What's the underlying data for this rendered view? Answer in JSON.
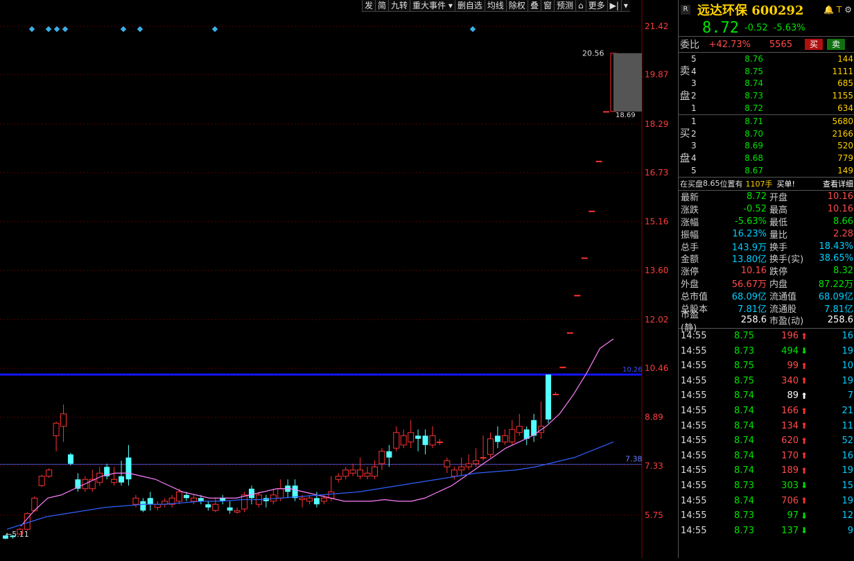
{
  "toolbar": {
    "items": [
      "发",
      "简",
      "九转",
      "重大事件 ▾",
      "删自选",
      "均线",
      "除权",
      "叠",
      "窗",
      "预测",
      "⌂",
      "更多",
      "▶|",
      "▾"
    ]
  },
  "chart": {
    "y_labels": [
      "21.42",
      "19.87",
      "18.29",
      "16.73",
      "15.16",
      "13.60",
      "12.02",
      "10.46",
      "8.89",
      "7.33",
      "5.75"
    ],
    "annotations": {
      "high": "20.56",
      "low_box": "18.69",
      "line1": "10.26",
      "line2": "7.38",
      "low": "5.11"
    },
    "colors": {
      "up": "#ff3232",
      "down": "#54ffff",
      "ma1": "#ff80ff",
      "ma2": "#3060ff",
      "hline1": "#1414ff",
      "hline2": "#5050c8"
    }
  },
  "header": {
    "badge": "R",
    "name": "远达环保",
    "code": "600292",
    "icons": [
      "bell-icon",
      "T",
      "gear-icon"
    ]
  },
  "price": {
    "last": "8.72",
    "chg": "-0.52",
    "pct": "-5.63%"
  },
  "weibi": {
    "label": "委比",
    "pct": "+42.73%",
    "diff": "5565",
    "buy_btn": "买",
    "sell_btn": "卖"
  },
  "sell_side": {
    "label1": "卖",
    "label2": "盘",
    "rows": [
      {
        "lv": "5",
        "p": "8.76",
        "v": "144"
      },
      {
        "lv": "4",
        "p": "8.75",
        "v": "1111"
      },
      {
        "lv": "3",
        "p": "8.74",
        "v": "685"
      },
      {
        "lv": "2",
        "p": "8.73",
        "v": "1155"
      },
      {
        "lv": "1",
        "p": "8.72",
        "v": "634"
      }
    ]
  },
  "buy_side": {
    "label1": "买",
    "label2": "盘",
    "rows": [
      {
        "lv": "1",
        "p": "8.71",
        "v": "5680"
      },
      {
        "lv": "2",
        "p": "8.70",
        "v": "2166"
      },
      {
        "lv": "3",
        "p": "8.69",
        "v": "520"
      },
      {
        "lv": "4",
        "p": "8.68",
        "v": "779"
      },
      {
        "lv": "5",
        "p": "8.67",
        "v": "149"
      }
    ]
  },
  "info": {
    "text1": "在买盘",
    "price": "8.65",
    "text2": "位置有",
    "vol": "1107手",
    "text3": "买单!",
    "link": "查看详细"
  },
  "stats": [
    {
      "k": "最新",
      "v": "8.72",
      "vc": "grn",
      "k2": "开盘",
      "v2": "10.16",
      "v2c": "red"
    },
    {
      "k": "涨跌",
      "v": "-0.52",
      "vc": "grn",
      "k2": "最高",
      "v2": "10.16",
      "v2c": "red"
    },
    {
      "k": "涨幅",
      "v": "-5.63%",
      "vc": "grn",
      "k2": "最低",
      "v2": "8.66",
      "v2c": "grn"
    },
    {
      "k": "振幅",
      "v": "16.23%",
      "vc": "cyan",
      "k2": "量比",
      "v2": "2.28",
      "v2c": "red"
    },
    {
      "k": "总手",
      "v": "143.9万",
      "vc": "cyan",
      "k2": "换手",
      "v2": "18.43%",
      "v2c": "cyan"
    },
    {
      "k": "金额",
      "v": "13.80亿",
      "vc": "cyan",
      "k2": "换手(实)",
      "v2": "38.65%",
      "v2c": "cyan"
    },
    {
      "k": "涨停",
      "v": "10.16",
      "vc": "red",
      "k2": "跌停",
      "v2": "8.32",
      "v2c": "grn"
    },
    {
      "k": "外盘",
      "v": "56.67万",
      "vc": "red",
      "k2": "内盘",
      "v2": "87.22万",
      "v2c": "grn"
    },
    {
      "k": "总市值",
      "v": "68.09亿",
      "vc": "cyan",
      "k2": "流通值",
      "v2": "68.09亿",
      "v2c": "cyan"
    },
    {
      "k": "总股本",
      "v": "7.81亿",
      "vc": "cyan",
      "k2": "流通股",
      "v2": "7.81亿",
      "v2c": "cyan"
    },
    {
      "k": "市盈(静)",
      "v": "258.6",
      "vc": "wht",
      "k2": "市盈(动)",
      "v2": "258.6",
      "v2c": "wht"
    }
  ],
  "ticks": [
    {
      "t": "14:55",
      "p": "8.75",
      "pc": "grn",
      "v": "196",
      "vc": "red",
      "a": "up",
      "n": "16"
    },
    {
      "t": "14:55",
      "p": "8.73",
      "pc": "grn",
      "v": "494",
      "vc": "grn",
      "a": "down",
      "n": "19"
    },
    {
      "t": "14:55",
      "p": "8.75",
      "pc": "grn",
      "v": "99",
      "vc": "red",
      "a": "up",
      "n": "10"
    },
    {
      "t": "14:55",
      "p": "8.75",
      "pc": "grn",
      "v": "340",
      "vc": "red",
      "a": "up",
      "n": "19"
    },
    {
      "t": "14:55",
      "p": "8.74",
      "pc": "grn",
      "v": "89",
      "vc": "wht",
      "a": "up-w",
      "n": "7"
    },
    {
      "t": "14:55",
      "p": "8.74",
      "pc": "grn",
      "v": "166",
      "vc": "red",
      "a": "up",
      "n": "21"
    },
    {
      "t": "14:55",
      "p": "8.74",
      "pc": "grn",
      "v": "134",
      "vc": "red",
      "a": "up",
      "n": "11"
    },
    {
      "t": "14:55",
      "p": "8.74",
      "pc": "grn",
      "v": "620",
      "vc": "red",
      "a": "up",
      "n": "52"
    },
    {
      "t": "14:55",
      "p": "8.74",
      "pc": "grn",
      "v": "170",
      "vc": "red",
      "a": "up",
      "n": "16"
    },
    {
      "t": "14:55",
      "p": "8.74",
      "pc": "grn",
      "v": "189",
      "vc": "red",
      "a": "up",
      "n": "19"
    },
    {
      "t": "14:55",
      "p": "8.73",
      "pc": "grn",
      "v": "303",
      "vc": "grn",
      "a": "down",
      "n": "15"
    },
    {
      "t": "14:55",
      "p": "8.74",
      "pc": "grn",
      "v": "706",
      "vc": "red",
      "a": "up",
      "n": "19"
    },
    {
      "t": "14:55",
      "p": "8.73",
      "pc": "grn",
      "v": "97",
      "vc": "grn",
      "a": "down",
      "n": "12"
    },
    {
      "t": "14:55",
      "p": "8.73",
      "pc": "grn",
      "v": "137",
      "vc": "grn",
      "a": "down",
      "n": "9"
    }
  ],
  "chart_data": {
    "type": "candlestick",
    "ylim": [
      5.11,
      21.42
    ],
    "y_ticks": [
      21.42,
      19.87,
      18.29,
      16.73,
      15.16,
      13.6,
      12.02,
      10.46,
      8.89,
      7.33,
      5.75
    ],
    "candles": [
      [
        5.1,
        5.0,
        5.12,
        4.98
      ],
      [
        5.1,
        5.05,
        5.12,
        5.0
      ],
      [
        5.15,
        5.3,
        5.35,
        5.1
      ],
      [
        5.3,
        5.8,
        5.85,
        5.25
      ],
      [
        5.9,
        6.3,
        6.35,
        5.85
      ],
      [
        6.7,
        7.0,
        7.05,
        6.65
      ],
      [
        7.0,
        7.2,
        7.25,
        6.95
      ],
      [
        8.3,
        8.7,
        8.75,
        7.8
      ],
      [
        8.6,
        9.0,
        9.3,
        8.1
      ],
      [
        7.7,
        7.4,
        7.75,
        7.35
      ],
      [
        6.9,
        6.6,
        7.1,
        6.5
      ],
      [
        6.6,
        6.9,
        7.0,
        6.5
      ],
      [
        6.6,
        6.9,
        7.2,
        6.5
      ],
      [
        6.8,
        7.1,
        7.3,
        6.7
      ],
      [
        7.3,
        7.0,
        7.4,
        6.9
      ],
      [
        6.8,
        6.9,
        7.3,
        6.7
      ],
      [
        7.0,
        6.8,
        7.5,
        6.7
      ],
      [
        7.6,
        6.9,
        8.0,
        6.7
      ],
      [
        6.1,
        6.3,
        6.4,
        6.0
      ],
      [
        6.2,
        5.9,
        6.3,
        5.85
      ],
      [
        6.3,
        6.1,
        6.5,
        5.9
      ],
      [
        6.0,
        6.1,
        6.2,
        5.9
      ],
      [
        6.1,
        6.2,
        6.3,
        6.0
      ],
      [
        6.1,
        6.3,
        6.4,
        6.0
      ],
      [
        6.2,
        6.5,
        6.6,
        6.1
      ],
      [
        6.4,
        6.3,
        6.5,
        6.2
      ],
      [
        6.2,
        6.3,
        6.4,
        6.1
      ],
      [
        6.3,
        6.2,
        6.4,
        6.1
      ],
      [
        6.1,
        6.0,
        6.2,
        5.9
      ],
      [
        5.9,
        6.1,
        6.3,
        5.85
      ],
      [
        6.3,
        6.2,
        6.4,
        6.1
      ],
      [
        6.0,
        5.9,
        6.2,
        5.8
      ],
      [
        5.85,
        5.9,
        6.0,
        5.8
      ],
      [
        5.95,
        6.4,
        6.5,
        5.85
      ],
      [
        6.6,
        6.3,
        6.7,
        6.1
      ],
      [
        6.1,
        6.4,
        6.5,
        6.0
      ],
      [
        6.3,
        6.2,
        6.4,
        6.0
      ],
      [
        6.2,
        6.4,
        6.6,
        6.1
      ],
      [
        6.3,
        6.6,
        6.9,
        6.2
      ],
      [
        6.7,
        6.5,
        6.9,
        6.3
      ],
      [
        6.7,
        6.3,
        6.9,
        6.2
      ],
      [
        6.25,
        6.3,
        6.4,
        6.0
      ],
      [
        6.2,
        6.3,
        6.4,
        6.1
      ],
      [
        6.3,
        6.1,
        6.5,
        6.0
      ],
      [
        6.2,
        6.3,
        6.4,
        6.1
      ],
      [
        6.3,
        6.5,
        7.0,
        6.2
      ],
      [
        6.9,
        7.0,
        7.1,
        6.8
      ],
      [
        7.0,
        7.2,
        7.3,
        6.9
      ],
      [
        7.1,
        7.2,
        7.4,
        7.0
      ],
      [
        7.0,
        7.2,
        7.6,
        6.9
      ],
      [
        7.0,
        7.1,
        7.3,
        6.9
      ],
      [
        7.0,
        7.3,
        7.5,
        6.9
      ],
      [
        7.4,
        7.8,
        7.9,
        7.2
      ],
      [
        7.8,
        7.6,
        8.0,
        7.3
      ],
      [
        7.9,
        8.4,
        8.6,
        7.8
      ],
      [
        8.0,
        8.3,
        8.5,
        7.9
      ],
      [
        8.1,
        8.4,
        8.8,
        7.9
      ],
      [
        8.3,
        8.2,
        8.5,
        7.8
      ],
      [
        8.3,
        8.0,
        8.5,
        7.7
      ],
      [
        8.0,
        8.3,
        8.6,
        7.9
      ],
      [
        8.1,
        8.1,
        8.2,
        8.0
      ],
      [
        7.3,
        7.5,
        7.6,
        7.1
      ],
      [
        7.0,
        7.2,
        7.3,
        6.9
      ],
      [
        7.2,
        7.3,
        7.6,
        7.0
      ],
      [
        7.3,
        7.4,
        7.7,
        7.2
      ],
      [
        7.4,
        7.5,
        7.9,
        7.3
      ],
      [
        7.6,
        7.6,
        8.3,
        7.5
      ],
      [
        7.7,
        8.2,
        8.4,
        7.6
      ],
      [
        8.3,
        8.1,
        8.6,
        7.9
      ],
      [
        8.1,
        8.3,
        8.5,
        8.0
      ],
      [
        8.1,
        8.5,
        8.8,
        8.0
      ],
      [
        8.4,
        8.6,
        9.0,
        8.3
      ],
      [
        8.5,
        8.2,
        8.6,
        8.0
      ],
      [
        8.8,
        8.3,
        9.0,
        8.1
      ],
      [
        8.4,
        8.6,
        9.4,
        8.2
      ],
      [
        10.26,
        8.82,
        10.26,
        8.7
      ],
      [
        9.63,
        9.63,
        9.7,
        9.6
      ],
      [
        10.5,
        10.5,
        10.5,
        10.5
      ],
      [
        11.6,
        11.6,
        11.6,
        11.6
      ],
      [
        12.8,
        12.8,
        12.8,
        12.8
      ],
      [
        14.0,
        14.0,
        14.0,
        14.0
      ],
      [
        15.5,
        15.5,
        15.5,
        15.5
      ],
      [
        17.1,
        17.1,
        17.1,
        17.1
      ],
      [
        18.69,
        18.69,
        18.69,
        18.69
      ],
      [
        18.69,
        20.56,
        20.56,
        18.69
      ]
    ],
    "ma_fast": [
      5.4,
      5.9,
      6.3,
      6.4,
      6.6,
      6.8,
      7.0,
      7.1,
      7.1,
      7.0,
      6.9,
      6.7,
      6.5,
      6.4,
      6.3,
      6.3,
      6.3,
      6.4,
      6.5,
      6.6,
      6.6,
      6.5,
      6.4,
      6.3,
      6.2,
      6.2,
      6.2,
      6.25,
      6.2,
      6.2,
      6.3,
      6.5,
      6.7,
      7.0,
      7.3,
      7.6,
      7.9,
      8.1,
      8.3,
      8.6,
      9.0,
      9.6,
      10.3,
      11.1,
      11.4
    ],
    "ma_slow": [
      5.3,
      5.5,
      5.7,
      5.8,
      5.9,
      6.0,
      6.05,
      6.1,
      6.1,
      6.15,
      6.2,
      6.2,
      6.25,
      6.25,
      6.3,
      6.35,
      6.4,
      6.45,
      6.5,
      6.6,
      6.7,
      6.8,
      6.9,
      7.0,
      7.1,
      7.15,
      7.2,
      7.3,
      7.45,
      7.6,
      7.85,
      8.1
    ]
  }
}
